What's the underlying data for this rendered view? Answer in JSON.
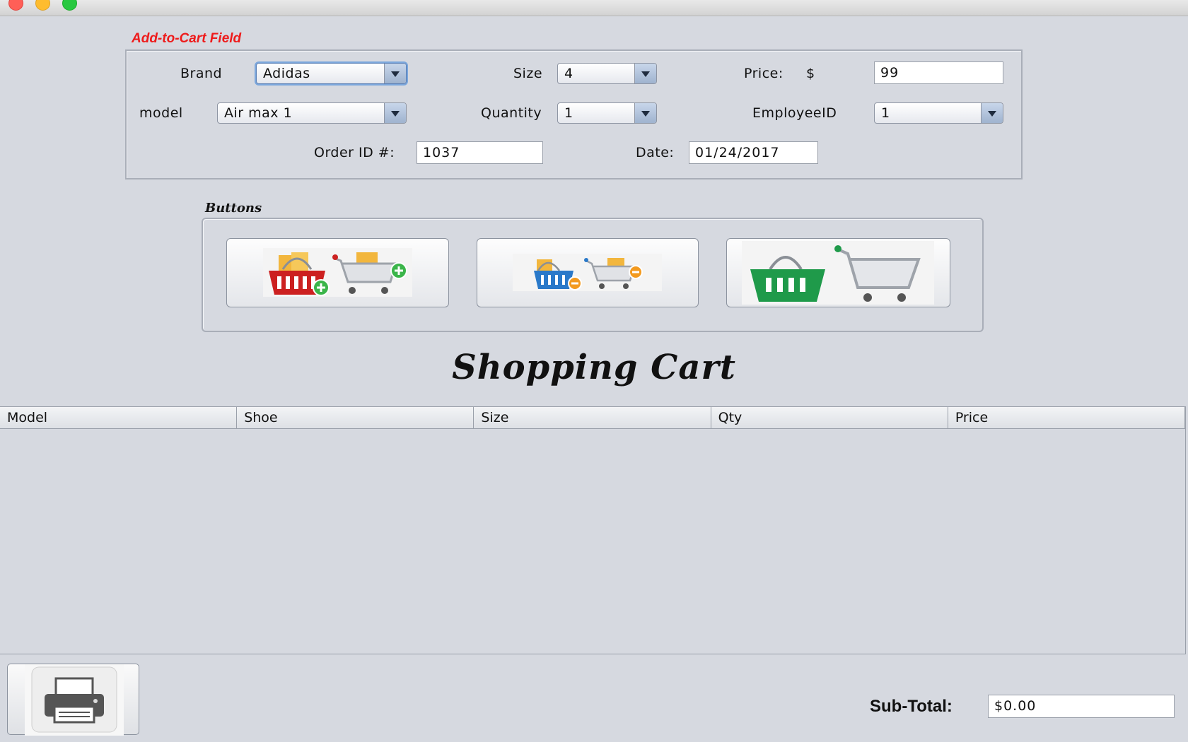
{
  "window": {
    "title": ""
  },
  "add_to_cart": {
    "legend": "Add-to-Cart Field",
    "brand_label": "Brand",
    "brand_value": "Adidas",
    "size_label": "Size",
    "size_value": "4",
    "price_label": "Price:",
    "price_currency": "$",
    "price_value": "99",
    "model_label": "model",
    "model_value": "Air max 1",
    "quantity_label": "Quantity",
    "quantity_value": "1",
    "employee_label": "EmployeeID",
    "employee_value": "1",
    "order_label": "Order ID #:",
    "order_value": "1037",
    "date_label": "Date:",
    "date_value": "01/24/2017"
  },
  "buttons": {
    "legend": "Buttons",
    "items": [
      {
        "icon": "add-to-cart-icon"
      },
      {
        "icon": "remove-from-cart-icon"
      },
      {
        "icon": "checkout-cart-icon"
      }
    ]
  },
  "cart": {
    "heading": "Shopping Cart",
    "columns": [
      "Model",
      "Shoe",
      "Size",
      "Qty",
      "Price"
    ],
    "rows": []
  },
  "footer": {
    "print_icon": "printer-icon",
    "subtotal_label": "Sub-Total:",
    "subtotal_value": "$0.00"
  },
  "colors": {
    "accent_red": "#ee1b1b",
    "basket_red": "#cc2020",
    "basket_blue": "#2a79c9",
    "basket_green": "#1f9a4a",
    "plus_green": "#3bb54a",
    "minus_orange": "#f39a1e"
  }
}
